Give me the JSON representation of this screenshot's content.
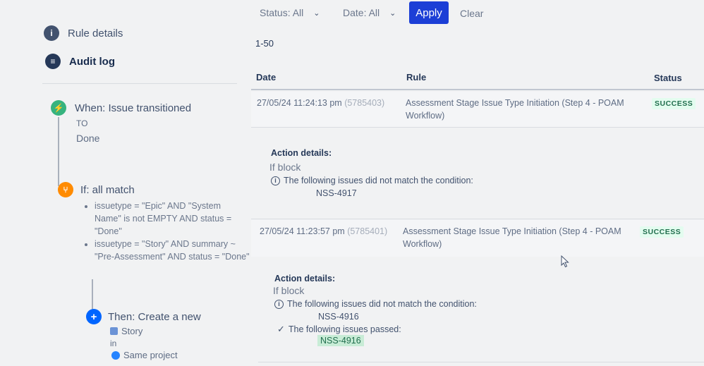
{
  "nav": {
    "rule_details": "Rule details",
    "audit_log": "Audit log"
  },
  "trigger": {
    "title": "When: Issue transitioned",
    "to_label": "TO",
    "to_value": "Done"
  },
  "condition": {
    "title": "If: all match",
    "items": [
      "issuetype = \"Epic\" AND \"System Name\" is not EMPTY AND status = \"Done\"",
      "issuetype = \"Story\" AND summary ~ \"Pre-Assessment\" AND status = \"Done\""
    ]
  },
  "action": {
    "title": "Then: Create a new",
    "issue_type": "Story",
    "in_label": "in",
    "project": "Same project"
  },
  "filters": {
    "status": "Status: All",
    "date": "Date: All",
    "apply": "Apply",
    "clear": "Clear"
  },
  "pagination": "1-50",
  "table": {
    "headers": {
      "date": "Date",
      "rule": "Rule",
      "status": "Status"
    },
    "rows": [
      {
        "date": "27/05/24 11:24:13 pm",
        "id": "(5785403)",
        "rule_line1": "Assessment Stage Issue Type Initiation (Step 4 - POAM",
        "rule_line2": "Workflow)",
        "status": "SUCCESS",
        "details_title": "Action details:",
        "details_block": "If block",
        "not_matched_text": "The following issues did not match the condition:",
        "not_matched_issue": "NSS-4917"
      },
      {
        "date": "27/05/24 11:23:57 pm",
        "id": "(5785401)",
        "rule_line1": "Assessment Stage Issue Type Initiation (Step 4 - POAM",
        "rule_line2": "Workflow)",
        "status": "SUCCESS",
        "details_title": "Action details:",
        "details_block": "If block",
        "not_matched_text": "The following issues did not match the condition:",
        "not_matched_issue": "NSS-4916",
        "passed_text": "The following issues passed:",
        "passed_issue": "NSS-4916"
      }
    ]
  },
  "colors": {
    "apply_button": "#1c3fd6",
    "success_lozenge_bg": "#e3fcef",
    "success_lozenge_text": "#216e4e",
    "trigger_icon": "#36b37e",
    "condition_icon": "#ff8b00",
    "action_icon": "#0065ff"
  },
  "icons": {
    "rule_details": "info-icon",
    "audit_log": "list-icon",
    "trigger": "lightning-icon",
    "condition": "branch-icon",
    "action": "plus-icon"
  }
}
